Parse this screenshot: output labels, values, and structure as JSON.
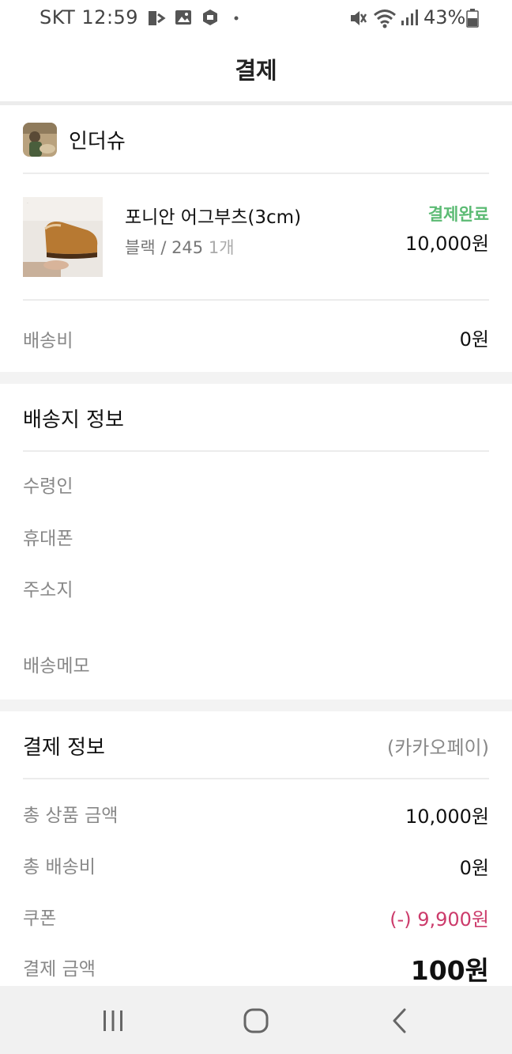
{
  "status_bar": {
    "carrier_time": "SKT 12:59",
    "battery": "43%",
    "icons": [
      "pay-icon",
      "gallery-icon",
      "box-app-icon",
      "dot-icon",
      "mute-vibrate-icon",
      "wifi-icon",
      "signal-icon",
      "battery-icon"
    ]
  },
  "header": {
    "title": "결제"
  },
  "store": {
    "name": "인더슈",
    "logo_icon": "store-logo-image"
  },
  "product": {
    "name": "포니안 어그부츠(3cm)",
    "option": "블랙 / 245",
    "quantity": "1개",
    "status": "결제완료",
    "price": "10,000원",
    "status_color": "#5cbb74"
  },
  "shipping_fee": {
    "label": "배송비",
    "value": "0원"
  },
  "delivery_info": {
    "title": "배송지 정보",
    "fields": {
      "recipient": "수령인",
      "phone": "휴대폰",
      "address": "주소지",
      "memo": "배송메모"
    }
  },
  "payment_info": {
    "title": "결제 정보",
    "method": "(카카오페이)",
    "rows": {
      "subtotal_label": "총 상품 금액",
      "subtotal_value": "10,000원",
      "shipping_label": "총 배송비",
      "shipping_value": "0원",
      "coupon_label": "쿠폰",
      "coupon_value": "(-) 9,900원",
      "total_label": "결제 금액",
      "total_value": "100원"
    },
    "coupon_color": "#cc3b6b"
  },
  "nav_bar": {
    "icons": [
      "recent-apps-icon",
      "home-icon",
      "back-icon"
    ]
  }
}
